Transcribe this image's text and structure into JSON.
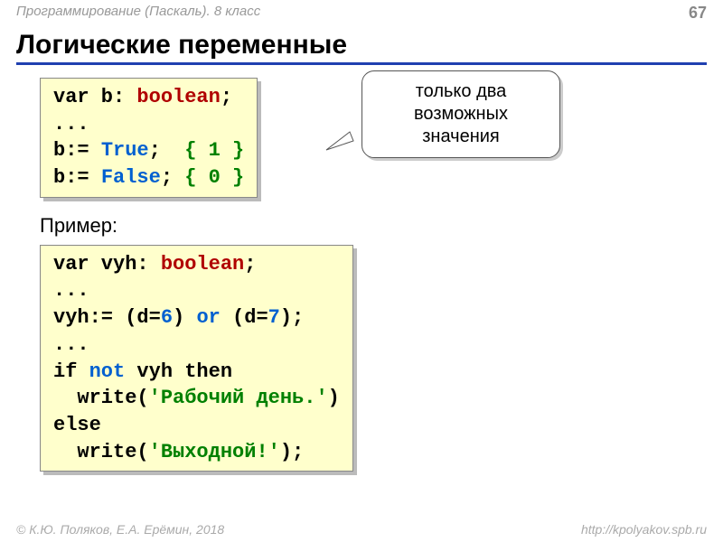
{
  "header": {
    "topic": "Программирование (Паскаль). 8 класс",
    "page_number": "67"
  },
  "title": "Логические переменные",
  "code1": {
    "l1_var": "var",
    "l1_name": " b: ",
    "l1_type": "boolean",
    "l1_end": ";",
    "l2": "...",
    "l3_asg": "b:= ",
    "l3_val": "True",
    "l3_end": ";  ",
    "l3_comment": "{ 1 }",
    "l4_asg": "b:= ",
    "l4_val": "False",
    "l4_end": "; ",
    "l4_comment": "{ 0 }"
  },
  "callout": "только два возможных значения",
  "example_label": "Пример:",
  "code2": {
    "l1_var": "var",
    "l1_name": " vyh: ",
    "l1_type": "boolean",
    "l1_end": ";",
    "l2": "...",
    "l3_a": "vyh:= (d=",
    "l3_n1": "6",
    "l3_b": ") ",
    "l3_or": "or",
    "l3_c": " (d=",
    "l3_n2": "7",
    "l3_d": ");",
    "l4": "...",
    "l5_a": "if",
    "l5_b": " ",
    "l5_not": "not",
    "l5_c": " vyh ",
    "l5_then": "then",
    "l6_a": "  write(",
    "l6_str": "'Рабочий день.'",
    "l6_b": ")",
    "l7": "else",
    "l8_a": "  write(",
    "l8_str": "'Выходной!'",
    "l8_b": ");"
  },
  "footer": {
    "copyright": "© К.Ю. Поляков, Е.А. Ерёмин, 2018",
    "url": "http://kpolyakov.spb.ru"
  }
}
